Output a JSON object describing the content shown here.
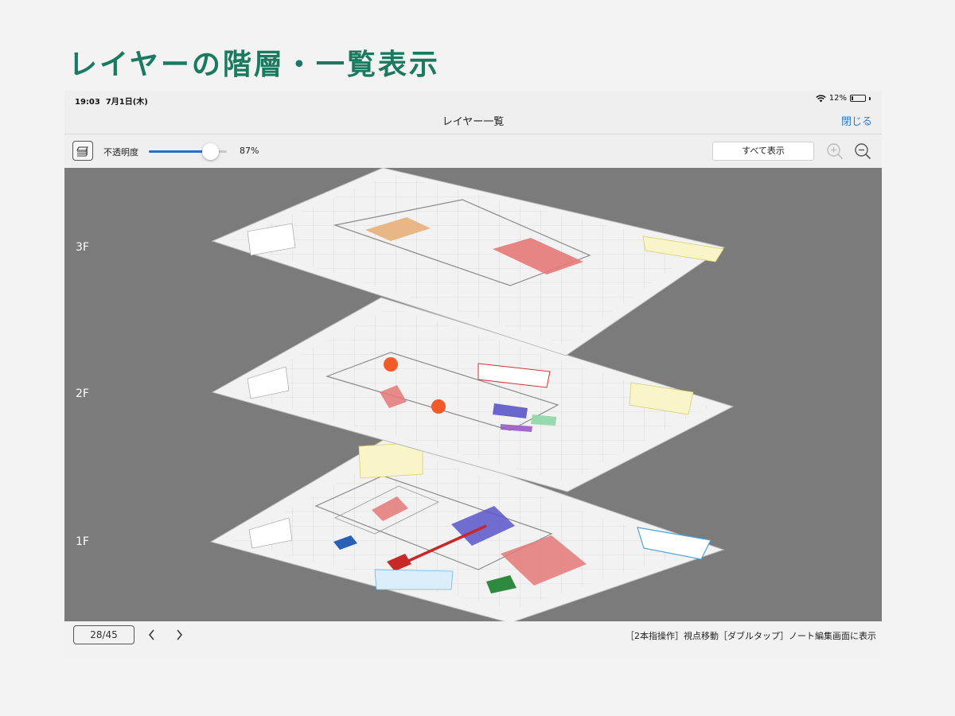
{
  "heading": "レイヤーの階層・一覧表示",
  "status": {
    "time": "19:03",
    "date": "7月1日(木)",
    "battery_text": "12%",
    "battery_level": 0.12
  },
  "nav": {
    "title": "レイヤー一覧",
    "close_label": "閉じる"
  },
  "toolbar": {
    "opacity_label": "不透明度",
    "opacity_value_text": "87%",
    "opacity_level": 0.87,
    "show_all_label": "すべて表示",
    "zoom_in_icon": "zoom-in-icon",
    "zoom_out_icon": "zoom-out-icon",
    "layers_icon": "layers-icon"
  },
  "floors": [
    {
      "label": "3F"
    },
    {
      "label": "2F"
    },
    {
      "label": "1F"
    }
  ],
  "bottom": {
    "page_indicator": "28/45",
    "hint": "［2本指操作］視点移動［ダブルタップ］ノート編集画面に表示"
  },
  "colors": {
    "heading": "#1a7a5f",
    "accent_blue": "#2a7cd6",
    "slider_fill": "#2f6bc9",
    "viewer_bg": "#7b7b7b"
  }
}
